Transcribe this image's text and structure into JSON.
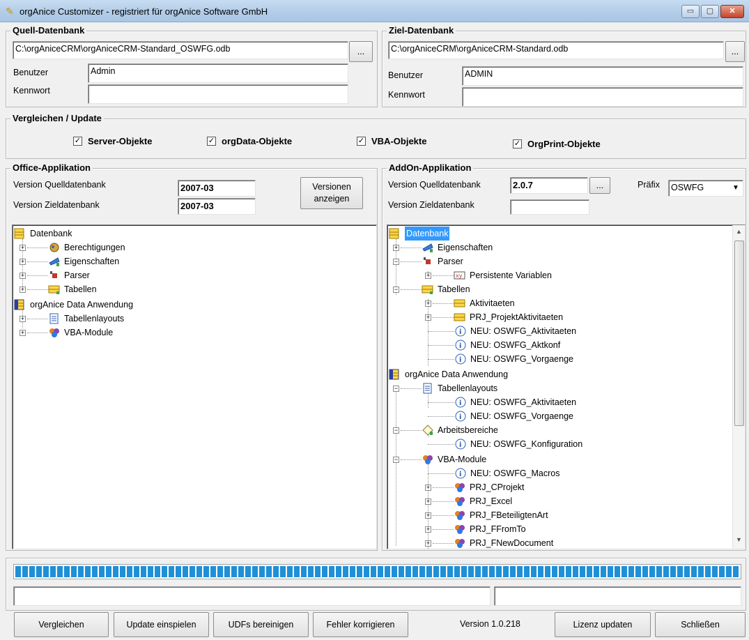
{
  "window": {
    "title": "orgAnice Customizer - registriert für orgAnice Software GmbH",
    "controls": {
      "minimize": "▭",
      "maximize": "▢",
      "close": "✕"
    }
  },
  "source_db": {
    "title": "Quell-Datenbank",
    "path": "C:\\orgAniceCRM\\orgAniceCRM-Standard_OSWFG.odb",
    "browse": "...",
    "user_label": "Benutzer",
    "user": "Admin",
    "password_label": "Kennwort",
    "password": ""
  },
  "target_db": {
    "title": "Ziel-Datenbank",
    "path": "C:\\orgAniceCRM\\orgAniceCRM-Standard.odb",
    "browse": "...",
    "user_label": "Benutzer",
    "user": "ADMIN",
    "password_label": "Kennwort",
    "password": ""
  },
  "compare": {
    "title": "Vergleichen / Update",
    "options": [
      {
        "label": "Server-Objekte",
        "checked": true
      },
      {
        "label": "orgData-Objekte",
        "checked": true
      },
      {
        "label": "VBA-Objekte",
        "checked": true
      },
      {
        "label": "OrgPrint-Objekte",
        "checked": true
      }
    ],
    "check_mark": "✓"
  },
  "office_app": {
    "title": "Office-Applikation",
    "version_source_label": "Version Quelldatenbank",
    "version_source": "2007-03",
    "version_target_label": "Version Zieldatenbank",
    "version_target": "2007-03",
    "show_versions_line1": "Versionen",
    "show_versions_line2": "anzeigen",
    "tree": [
      {
        "label": "Datenbank",
        "icon": "database-icon"
      },
      {
        "label": "Berechtigungen",
        "icon": "permissions-icon"
      },
      {
        "label": "Eigenschaften",
        "icon": "properties-icon"
      },
      {
        "label": "Parser",
        "icon": "parser-icon"
      },
      {
        "label": "Tabellen",
        "icon": "table-icon"
      },
      {
        "label": "orgAnice Data Anwendung",
        "icon": "application-icon"
      },
      {
        "label": "Tabellenlayouts",
        "icon": "layout-icon"
      },
      {
        "label": "VBA-Module",
        "icon": "vba-icon"
      }
    ]
  },
  "addon_app": {
    "title": "AddOn-Applikation",
    "version_source_label": "Version Quelldatenbank",
    "version_source": "2.0.7",
    "browse": "...",
    "prefix_label": "Präfix",
    "prefix": "OSWFG",
    "version_target_label": "Version Zieldatenbank",
    "version_target": "",
    "tree": [
      {
        "label": "Datenbank",
        "icon": "database-icon"
      },
      {
        "label": "Eigenschaften",
        "icon": "properties-icon"
      },
      {
        "label": "Parser",
        "icon": "parser-icon"
      },
      {
        "label": "Persistente Variablen",
        "icon": "variable-icon"
      },
      {
        "label": "Tabellen",
        "icon": "table-icon"
      },
      {
        "label": "Aktivitaeten",
        "icon": "table-icon"
      },
      {
        "label": "PRJ_ProjektAktivitaeten",
        "icon": "table-icon"
      },
      {
        "label": "NEU: OSWFG_Aktivitaeten",
        "icon": "info-icon"
      },
      {
        "label": "NEU: OSWFG_Aktkonf",
        "icon": "info-icon"
      },
      {
        "label": "NEU: OSWFG_Vorgaenge",
        "icon": "info-icon"
      },
      {
        "label": "orgAnice Data Anwendung",
        "icon": "application-icon"
      },
      {
        "label": "Tabellenlayouts",
        "icon": "layout-icon"
      },
      {
        "label": "NEU: OSWFG_Aktivitaeten",
        "icon": "info-icon"
      },
      {
        "label": "NEU: OSWFG_Vorgaenge",
        "icon": "info-icon"
      },
      {
        "label": "Arbeitsbereiche",
        "icon": "workspace-icon"
      },
      {
        "label": "NEU: OSWFG_Konfiguration",
        "icon": "info-icon"
      },
      {
        "label": "VBA-Module",
        "icon": "vba-icon"
      },
      {
        "label": "NEU: OSWFG_Macros",
        "icon": "info-icon"
      },
      {
        "label": "PRJ_CProjekt",
        "icon": "vba-icon"
      },
      {
        "label": "PRJ_Excel",
        "icon": "vba-icon"
      },
      {
        "label": "PRJ_FBeteiligtenArt",
        "icon": "vba-icon"
      },
      {
        "label": "PRJ_FFromTo",
        "icon": "vba-icon"
      },
      {
        "label": "PRJ_FNewDocument",
        "icon": "vba-icon"
      }
    ]
  },
  "progress": {
    "fraction": 1.0
  },
  "status": {
    "left": "",
    "right": ""
  },
  "footer": {
    "compare": "Vergleichen",
    "apply_update": "Update einspielen",
    "clean_udfs": "UDFs bereinigen",
    "fix_errors": "Fehler korrigieren",
    "version": "Version 1.0.218",
    "update_license": "Lizenz updaten",
    "close": "Schließen"
  },
  "colors": {
    "selection": "#3399ff",
    "progress": "#1e90d8"
  }
}
